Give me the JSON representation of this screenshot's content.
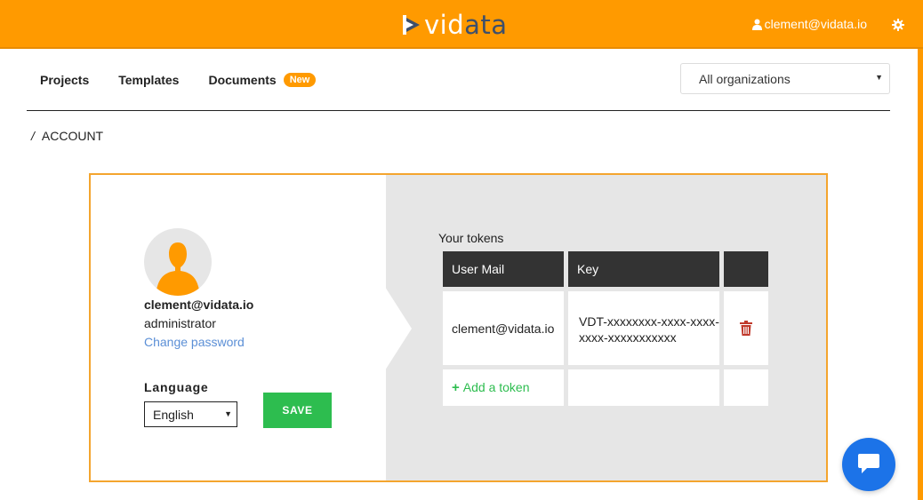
{
  "header": {
    "logo_prefix": "vid",
    "logo_suffix": "ata",
    "user_email": "clement@vidata.io",
    "accent_color": "#ff9a00"
  },
  "nav": {
    "items": [
      {
        "label": "Projects"
      },
      {
        "label": "Templates"
      },
      {
        "label": "Documents",
        "badge": "New"
      }
    ],
    "organization_select": {
      "value": "All organizations"
    }
  },
  "breadcrumb": {
    "separator": "/",
    "current": "ACCOUNT"
  },
  "profile": {
    "email": "clement@vidata.io",
    "role": "administrator",
    "change_password_label": "Change password",
    "language_label": "Language",
    "language_value": "English",
    "save_label": "SAVE"
  },
  "tokens": {
    "title": "Your tokens",
    "columns": [
      "User Mail",
      "Key",
      ""
    ],
    "rows": [
      {
        "user_mail": "clement@vidata.io",
        "key": "VDT-xxxxxxxx-xxxx-xxxx-xxxx-xxxxxxxxxxx"
      }
    ],
    "add_label": "Add a token"
  },
  "icons": {
    "user": "user-icon",
    "settings": "gear-icon",
    "delete": "trash-icon",
    "chat": "chat-icon",
    "add": "plus-icon"
  }
}
